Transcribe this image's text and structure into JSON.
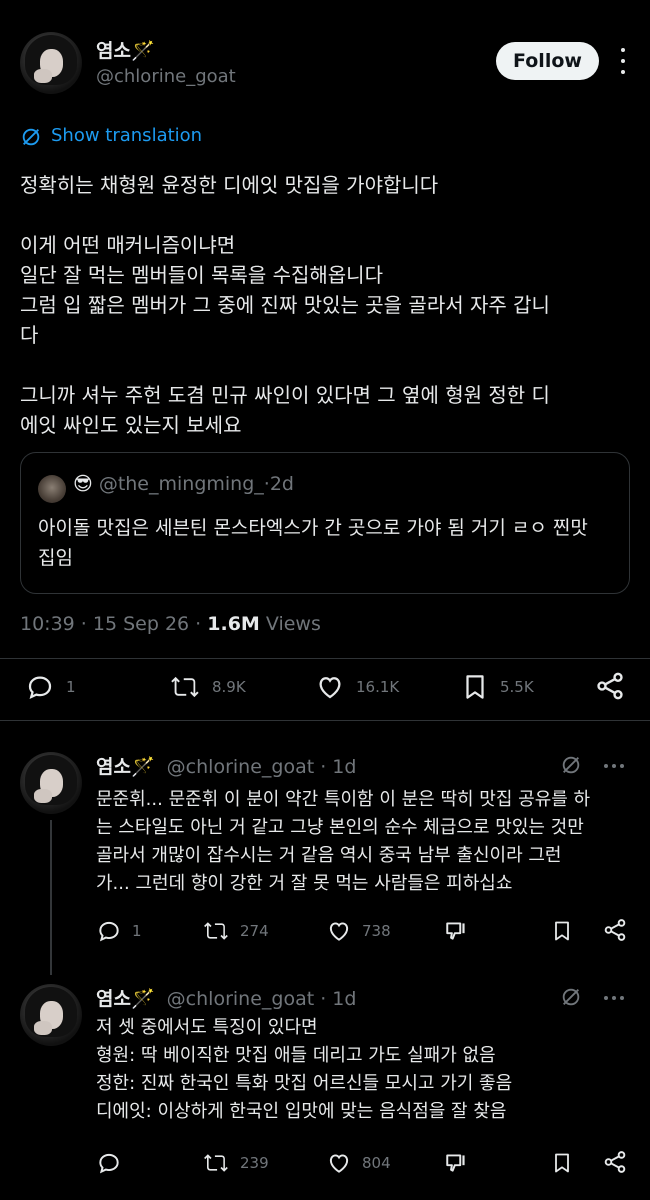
{
  "main_tweet": {
    "display_name": "염소🪄",
    "handle": "@chlorine_goat",
    "follow_label": "Follow",
    "translate_label": "Show translation",
    "body": "정확히는 채형원 윤정한 디에잇 맛집을 가야합니다\n\n이게 어떤 매커니즘이냐면\n일단 잘 먹는 멤버들이 목록을 수집해옵니다\n그럼 입 짧은 멤버가 그 중에 진짜 맛있는 곳을 골라서 자주 갑니\n다\n\n그니까 셔누 주헌 도겸 민규 싸인이 있다면 그 옆에 형원 정한 디\n에잇 싸인도 있는지 보세요",
    "quote": {
      "emoji": "😎",
      "handle": "@the_mingming_",
      "separator": " · ",
      "time": "2d",
      "body": "아이돌 맛집은 세븐틴 몬스타엑스가 간 곳으로 가야 됨 거기 ㄹㅇ 찐맛\n집임"
    },
    "meta": {
      "time": "10:39",
      "dot1": " · ",
      "date": "15 Sep 26",
      "dot2": " · ",
      "views_count": "1.6M",
      "views_label": " Views"
    },
    "stats": {
      "replies": "1",
      "reposts": "8.9K",
      "likes": "16.1K",
      "bookmarks": "5.5K"
    }
  },
  "replies": [
    {
      "display_name": "염소🪄",
      "handle": "@chlorine_goat",
      "separator": " · ",
      "time": "1d",
      "body": "문준휘... 문준휘 이 분이 약간 특이함 이 분은 딱히 맛집 공유를 하\n는 스타일도 아닌 거 같고 그냥 본인의 순수 체급으로 맛있는 것만\n골라서 개많이 잡수시는 거 같음 역시 중국 남부 출신이라 그런\n가... 그런데 향이 강한 거 잘 못 먹는 사람들은 피하십쇼",
      "stats": {
        "replies": "1",
        "reposts": "274",
        "likes": "738"
      }
    },
    {
      "display_name": "염소🪄",
      "handle": "@chlorine_goat",
      "separator": " · ",
      "time": "1d",
      "body": "저 셋 중에서도 특징이 있다면\n형원: 딱 베이직한 맛집 애들 데리고 가도 실패가 없음\n정한: 진짜 한국인 특화 맛집 어르신들 모시고 가기 좋음\n디에잇: 이상하게 한국인 입맛에 맞는 음식점을 잘 찾음",
      "stats": {
        "reposts": "239",
        "likes": "804"
      }
    }
  ]
}
